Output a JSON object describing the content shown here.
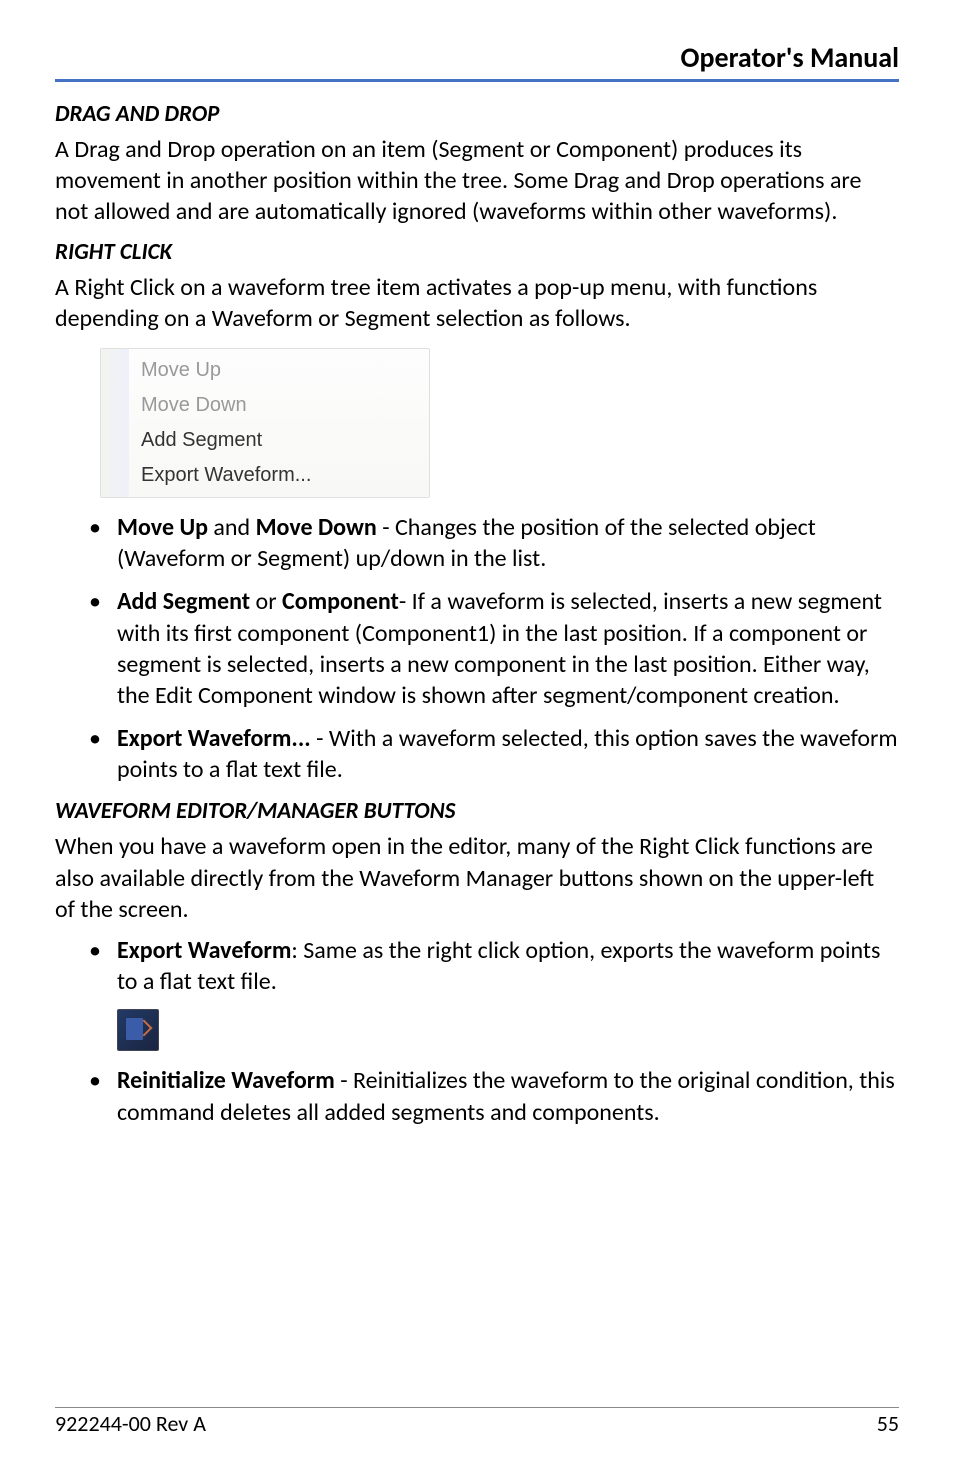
{
  "header": {
    "title": "Operator's Manual"
  },
  "sections": {
    "drag": {
      "heading": "DRAG AND DROP",
      "body": "A Drag and Drop operation on an item (Segment or Component) produces its movement in another position within the tree. Some Drag and Drop operations are not allowed and are automatically ignored (waveforms within other waveforms)."
    },
    "right": {
      "heading": "RIGHT CLICK",
      "body": "A Right Click on a waveform tree item activates a pop-up menu, with functions depending on a Waveform or Segment selection as follows."
    },
    "menu": {
      "items": [
        "Move Up",
        "Move Down",
        "Add Segment",
        "Export Waveform..."
      ]
    },
    "bullets1": {
      "b1": {
        "bold1": "Move Up",
        "mid": " and ",
        "bold2": "Move Down",
        "tail": " - Changes the position of the selected object (Waveform or Segment) up/down in the list."
      },
      "b2": {
        "bold1": "Add Segment",
        "mid": " or ",
        "bold2": "Component",
        "tail": "- If a waveform is selected, inserts a new segment with its first component (Component1) in the last position. If a component or segment is selected, inserts a new component in the last position. Either way, the Edit Component window is shown after segment/component creation."
      },
      "b3": {
        "bold": "Export Waveform...",
        "tail": " - With a waveform selected, this option saves the waveform points to a flat text file."
      }
    },
    "wf": {
      "heading": "WAVEFORM EDITOR/MANAGER BUTTONS",
      "body": "When you have a waveform open in the editor, many of the Right Click functions are also available directly from the Waveform Manager buttons shown on the upper-left of the screen."
    },
    "bullets2": {
      "b1": {
        "bold": "Export Waveform",
        "tail": ": Same as the right click option, exports the waveform points to a flat text file."
      },
      "b2": {
        "bold": "Reinitialize Waveform",
        "tail": " - Reinitializes the waveform to the original condition, this command deletes all added segments and components."
      }
    }
  },
  "footer": {
    "rev": "922244-00 Rev A",
    "page": "55"
  }
}
